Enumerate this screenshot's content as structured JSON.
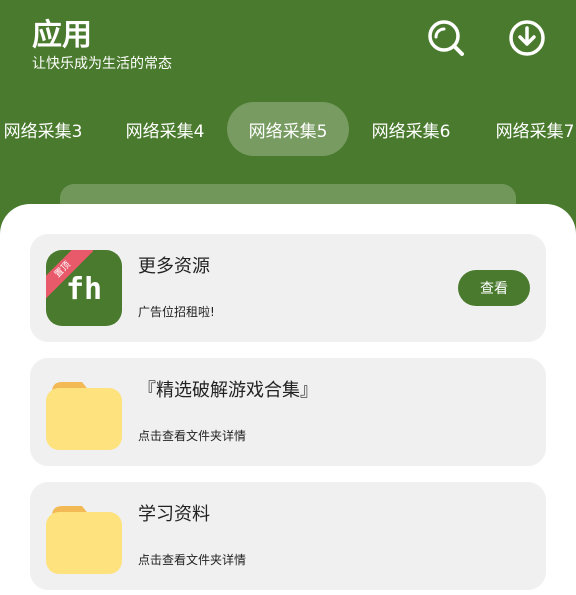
{
  "header": {
    "title": "应用",
    "subtitle": "让快乐成为生活的常态",
    "search_icon": "search-icon",
    "download_icon": "download-icon"
  },
  "tabs": [
    {
      "label": "网络采集3",
      "active": false
    },
    {
      "label": "网络采集4",
      "active": false
    },
    {
      "label": "网络采集5",
      "active": true
    },
    {
      "label": "网络采集6",
      "active": false
    },
    {
      "label": "网络采集7",
      "active": false
    }
  ],
  "cards": [
    {
      "title": "更多资源",
      "description": "广告位招租啦!",
      "logo_text": "fh",
      "ribbon_text": "置顶",
      "button_label": "查看"
    },
    {
      "title": "『精选破解游戏合集』",
      "description": "点击查看文件夹详情",
      "icon": "folder-icon"
    },
    {
      "title": "学习资料",
      "description": "点击查看文件夹详情",
      "icon": "folder-icon"
    }
  ],
  "colors": {
    "brand_green": "#4a7a2d",
    "card_bg": "#f0f0f0",
    "ribbon_red": "#e8596a",
    "folder_yellow": "#fde27e",
    "folder_tab": "#f2b955"
  }
}
